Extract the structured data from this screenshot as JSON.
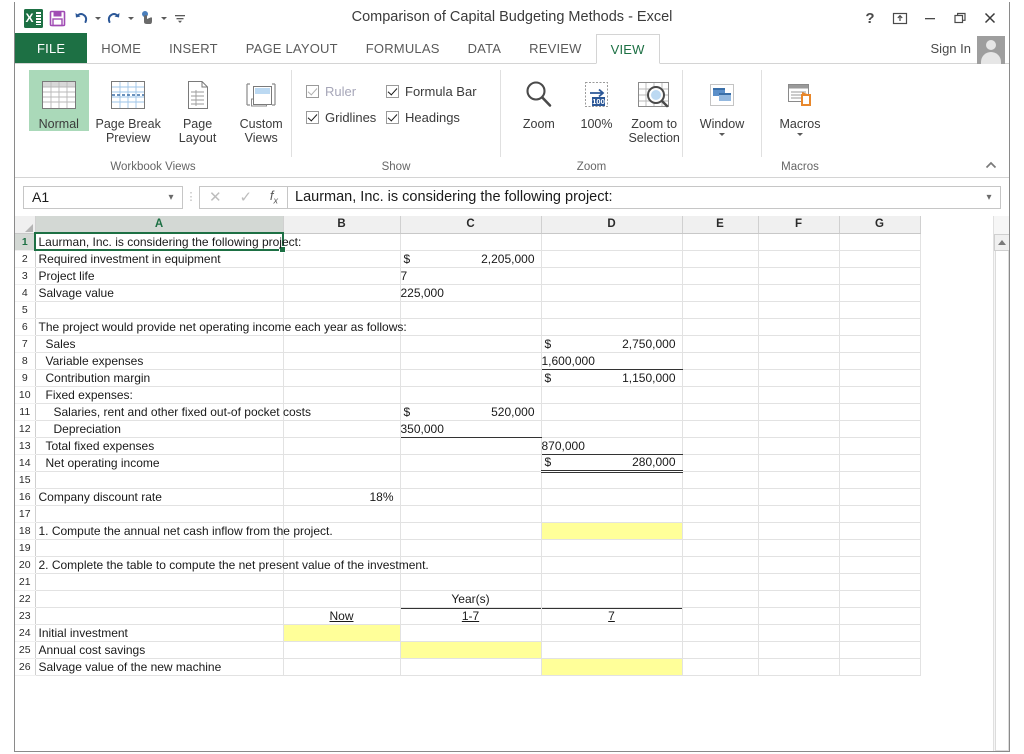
{
  "window": {
    "title": "Comparison of Capital Budgeting Methods - Excel",
    "help": "?",
    "ribbon_display": "ribbon-display-options-icon",
    "minimize": "minimize-icon",
    "restore": "restore-icon",
    "close": "close-icon"
  },
  "qat": {
    "logo": "excel-logo-icon",
    "items": [
      {
        "name": "save-icon",
        "glyph": "save"
      },
      {
        "name": "undo-icon",
        "glyph": "undo"
      },
      {
        "name": "redo-icon",
        "glyph": "redo"
      },
      {
        "name": "touch-mouse-mode-icon",
        "glyph": "touch"
      },
      {
        "name": "customize-quick-access-toolbar-icon",
        "glyph": "menu"
      }
    ]
  },
  "tabs": [
    {
      "label": "FILE",
      "active": false,
      "file": true
    },
    {
      "label": "HOME",
      "active": false
    },
    {
      "label": "INSERT",
      "active": false
    },
    {
      "label": "PAGE LAYOUT",
      "active": false
    },
    {
      "label": "FORMULAS",
      "active": false
    },
    {
      "label": "DATA",
      "active": false
    },
    {
      "label": "REVIEW",
      "active": false
    },
    {
      "label": "VIEW",
      "active": true
    }
  ],
  "signin": "Sign In",
  "ribbon": {
    "groups": [
      {
        "label": "Workbook Views",
        "buttons": [
          {
            "name": "normal-view-button",
            "line1": "Normal",
            "line2": "",
            "selected": true
          },
          {
            "name": "page-break-preview-button",
            "line1": "Page Break",
            "line2": "Preview",
            "selected": false
          },
          {
            "name": "page-layout-button",
            "line1": "Page",
            "line2": "Layout",
            "selected": false
          },
          {
            "name": "custom-views-button",
            "line1": "Custom",
            "line2": "Views",
            "selected": false
          }
        ]
      },
      {
        "label": "Show",
        "checks": [
          {
            "name": "ruler-checkbox",
            "label": "Ruler",
            "checked": true,
            "disabled": true
          },
          {
            "name": "formula-bar-checkbox",
            "label": "Formula Bar",
            "checked": true,
            "disabled": false
          },
          {
            "name": "gridlines-checkbox",
            "label": "Gridlines",
            "checked": true,
            "disabled": false
          },
          {
            "name": "headings-checkbox",
            "label": "Headings",
            "checked": true,
            "disabled": false
          }
        ]
      },
      {
        "label": "Zoom",
        "buttons": [
          {
            "name": "zoom-button",
            "line1": "Zoom",
            "line2": ""
          },
          {
            "name": "zoom-100-button",
            "line1": "100%",
            "line2": ""
          },
          {
            "name": "zoom-to-selection-button",
            "line1": "Zoom to",
            "line2": "Selection"
          }
        ]
      },
      {
        "label": "Macros",
        "buttons": [
          {
            "name": "window-button",
            "line1": "Window",
            "line2": ""
          },
          {
            "name": "macros-button",
            "line1": "Macros",
            "line2": ""
          }
        ]
      }
    ],
    "window_group_label": "Macros",
    "collapse": "collapse-ribbon-icon"
  },
  "formula_bar": {
    "name_box_value": "A1",
    "cancel": "cancel-icon",
    "enter": "enter-icon",
    "insert_function": "fx",
    "formula_value": "Laurman, Inc. is considering the following project:",
    "expand": "expand-formula-bar-icon"
  },
  "sheet": {
    "columns": [
      "A",
      "B",
      "C",
      "D",
      "E",
      "F",
      "G"
    ],
    "selected_column": "A",
    "selected_row": 1,
    "rows": [
      {
        "n": 1,
        "a": "Laurman, Inc. is considering the following project:",
        "b": "",
        "c": "",
        "d": ""
      },
      {
        "n": 2,
        "a": "Required investment in equipment",
        "b": "",
        "c_sym": "$",
        "c": "2,205,000",
        "d": ""
      },
      {
        "n": 3,
        "a": "Project life",
        "b": "",
        "c": "7",
        "d": ""
      },
      {
        "n": 4,
        "a": "Salvage value",
        "b": "",
        "c": "225,000",
        "d": ""
      },
      {
        "n": 5,
        "a": "",
        "b": "",
        "c": "",
        "d": ""
      },
      {
        "n": 6,
        "a": "The project would provide net operating income each year as follows:",
        "b": "",
        "c": "",
        "d": ""
      },
      {
        "n": 7,
        "a": "Sales",
        "indent": 1,
        "b": "",
        "c": "",
        "d_sym": "$",
        "d": "2,750,000"
      },
      {
        "n": 8,
        "a": "Variable expenses",
        "indent": 1,
        "b": "",
        "c": "",
        "d": "1,600,000",
        "d_rule": "bottom"
      },
      {
        "n": 9,
        "a": "Contribution margin",
        "indent": 1,
        "b": "",
        "c": "",
        "d_sym": "$",
        "d": "1,150,000"
      },
      {
        "n": 10,
        "a": "Fixed expenses:",
        "indent": 1,
        "b": "",
        "c": "",
        "d": ""
      },
      {
        "n": 11,
        "a": "Salaries, rent and other fixed out-of pocket costs",
        "indent": 2,
        "b": "",
        "c_sym": "$",
        "c": "520,000",
        "d": ""
      },
      {
        "n": 12,
        "a": "Depreciation",
        "indent": 2,
        "b": "",
        "c": "350,000",
        "c_rule": "bottom",
        "d": ""
      },
      {
        "n": 13,
        "a": "Total fixed expenses",
        "indent": 1,
        "b": "",
        "c": "",
        "d": "870,000",
        "d_rule": "bottom"
      },
      {
        "n": 14,
        "a": "Net operating income",
        "indent": 1,
        "b": "",
        "c": "",
        "d_sym": "$",
        "d": "280,000",
        "d_rule": "double"
      },
      {
        "n": 15,
        "a": "",
        "b": "",
        "c": "",
        "d": ""
      },
      {
        "n": 16,
        "a": "Company discount rate",
        "b": "18%",
        "b_align": "r",
        "c": "",
        "d": ""
      },
      {
        "n": 17,
        "a": "",
        "b": "",
        "c": "",
        "d": ""
      },
      {
        "n": 18,
        "a": "1. Compute the annual net cash inflow from the project.",
        "b": "",
        "c": "",
        "d": "",
        "d_fill": "yellow"
      },
      {
        "n": 19,
        "a": "",
        "b": "",
        "c": "",
        "d": ""
      },
      {
        "n": 20,
        "a": "2. Complete the table to compute the net present value of the investment.",
        "b": "",
        "c": "",
        "d": ""
      },
      {
        "n": 21,
        "a": "",
        "b": "",
        "c": "",
        "d": ""
      },
      {
        "n": 22,
        "a": "",
        "b": "",
        "c": "Year(s)",
        "c_align": "c",
        "d": ""
      },
      {
        "n": 23,
        "a": "",
        "b": "Now",
        "b_align": "c",
        "b_underline": true,
        "c": "1-7",
        "c_align": "c",
        "c_underline": true,
        "c_rule": "top",
        "d": "7",
        "d_align": "c",
        "d_underline": true,
        "d_rule": "top"
      },
      {
        "n": 24,
        "a": "Initial investment",
        "b": "",
        "b_fill": "yellow",
        "c": "",
        "d": ""
      },
      {
        "n": 25,
        "a": "Annual cost savings",
        "b": "",
        "c": "",
        "c_fill": "yellow",
        "d": ""
      },
      {
        "n": 26,
        "a": "Salvage value of the new machine",
        "b": "",
        "c": "",
        "d": "",
        "d_fill": "yellow"
      }
    ]
  },
  "scrollbar": {
    "up_arrow": "scroll-up-icon"
  },
  "colors": {
    "accent": "#1d7044",
    "highlight_fill": "#ffff99",
    "selection": "#1d7044"
  }
}
